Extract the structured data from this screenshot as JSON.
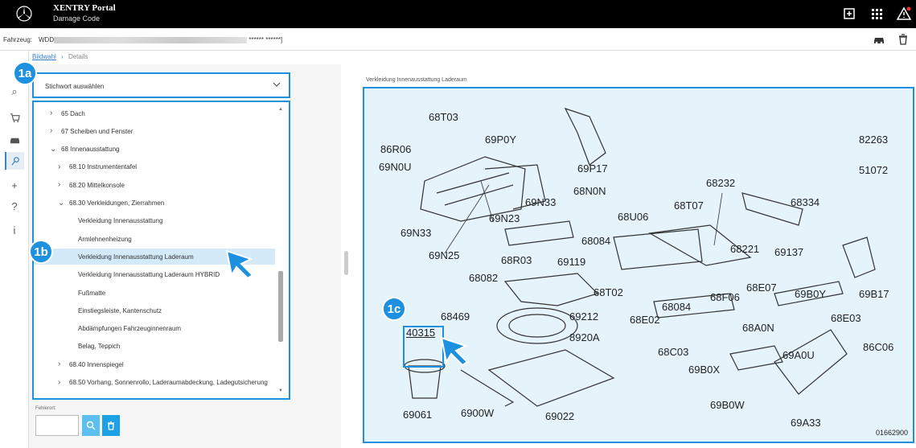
{
  "app": {
    "title": "XENTRY Portal",
    "subtitle": "Damage Code"
  },
  "vehicle": {
    "label": "Fahrzeug:",
    "vin_prefix": "WDD",
    "vin_suffix": "****** ******]"
  },
  "breadcrumb": {
    "first": "Bildwahl",
    "second": "Details"
  },
  "select": {
    "value": "Stichwort auswählen"
  },
  "tree": [
    {
      "label": "65 Dach",
      "arrow": "›"
    },
    {
      "label": "67 Scheiben und Fenster",
      "arrow": "›"
    },
    {
      "label": "68 Innenausstattung",
      "arrow": "⌄"
    },
    {
      "label": "68.10 Instrumententafel",
      "arrow": "›"
    },
    {
      "label": "68.20 Mittelkonsole",
      "arrow": "›"
    },
    {
      "label": "68.30 Verkleidungen, Zierrahmen",
      "arrow": "⌄"
    },
    {
      "label": "Verkleidung Innenausstattung",
      "arrow": ""
    },
    {
      "label": "Armlehnenheizung",
      "arrow": ""
    },
    {
      "label": "Verkleidung Innenausstattung Laderaum",
      "arrow": ""
    },
    {
      "label": "Verkleidung Innenausstattung Laderaum HYBRID",
      "arrow": ""
    },
    {
      "label": "Fußmatte",
      "arrow": ""
    },
    {
      "label": "Einstiegsleiste, Kantenschutz",
      "arrow": ""
    },
    {
      "label": "Abdämpfungen Fahrzeuginnenraum",
      "arrow": ""
    },
    {
      "label": "Belag, Teppich",
      "arrow": ""
    },
    {
      "label": "68.40 Innenspiegel",
      "arrow": "›"
    },
    {
      "label": "68.50 Vorhang, Sonnenrollo, Laderaumabdeckung, Ladegutsicherung",
      "arrow": "›"
    }
  ],
  "fehlerort": {
    "label": "Fehlerort:"
  },
  "diagram": {
    "title": "Verkleidung Innenausstattung Laderaum",
    "id": "01662900",
    "parts": [
      "68T03",
      "86R06",
      "69P0Y",
      "69N0U",
      "69P17",
      "82263",
      "51072",
      "68232",
      "68N0N",
      "69N33",
      "68334",
      "68T07",
      "68U06",
      "69N23",
      "69N33",
      "68084",
      "68221",
      "69137",
      "69N25",
      "68R03",
      "69119",
      "69B17",
      "68082",
      "68T02",
      "68E07",
      "69B0Y",
      "68F06",
      "68084",
      "68469",
      "69212",
      "68E02",
      "68A0N",
      "68E03",
      "40315",
      "8920A",
      "68C03",
      "86C06",
      "69A0U",
      "69B0X",
      "69061",
      "6900W",
      "69022",
      "69B0W",
      "69A33"
    ]
  },
  "badges": {
    "a": "1a",
    "b": "1b",
    "c": "1c"
  },
  "rail_icons": [
    "search-icon",
    "cart-icon",
    "car-icon",
    "key-icon",
    "plus-icon",
    "help-icon",
    "info-icon"
  ]
}
